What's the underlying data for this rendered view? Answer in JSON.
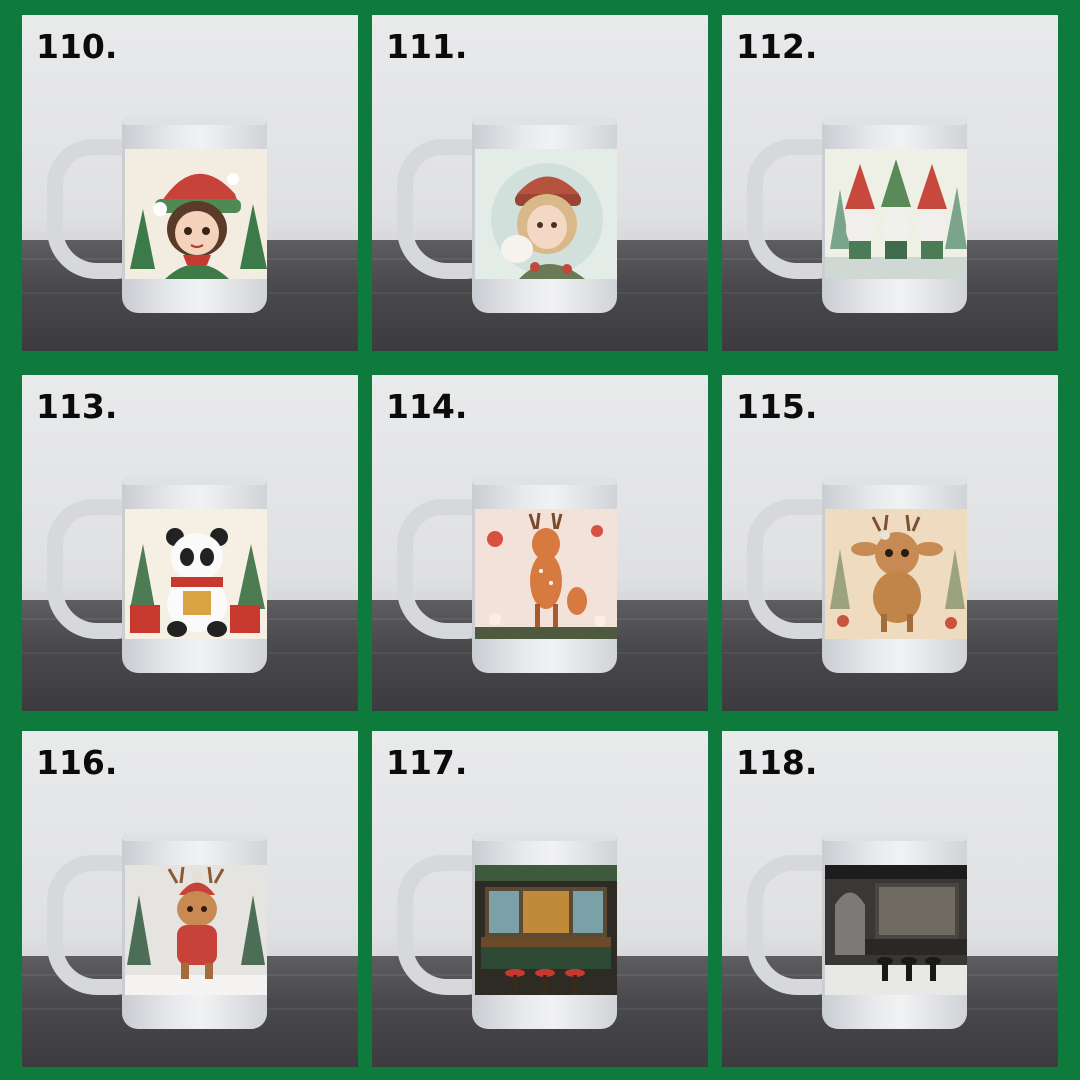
{
  "panels": [
    {
      "label": "110.",
      "design": "elf-girl"
    },
    {
      "label": "111.",
      "design": "girl-with-cat"
    },
    {
      "label": "112.",
      "design": "three-gnomes"
    },
    {
      "label": "113.",
      "design": "panda-with-gifts"
    },
    {
      "label": "114.",
      "design": "two-deer"
    },
    {
      "label": "115.",
      "design": "fawn"
    },
    {
      "label": "116.",
      "design": "reindeer-in-scarf"
    },
    {
      "label": "117.",
      "design": "christmas-bar"
    },
    {
      "label": "118.",
      "design": "gothic-bar"
    }
  ],
  "colors": {
    "frame": "#0e7a3c",
    "label": "#0b0b0b"
  }
}
